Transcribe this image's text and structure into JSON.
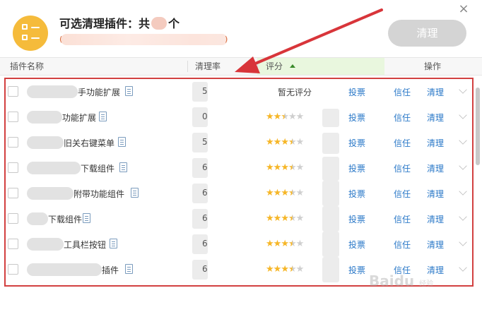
{
  "header": {
    "title_prefix": "可选清理插件：共",
    "title_suffix": "个",
    "subtitle_open": "(",
    "subtitle_close": ")",
    "clean_button": "清理",
    "close_icon": "×"
  },
  "table": {
    "columns": {
      "name": "插件名称",
      "rate": "清理率",
      "rating": "评分",
      "action": "操作"
    },
    "sort_indicator": "ascending",
    "rows": [
      {
        "name": "手功能扩展",
        "rate": "5",
        "rating": null,
        "rating_text": "暂无评分",
        "vote": "投票",
        "trust": "信任",
        "clean": "清理"
      },
      {
        "name": "功能扩展",
        "rate": "0",
        "rating": 2.5,
        "vote": "投票",
        "trust": "信任",
        "clean": "清理"
      },
      {
        "name": "旧关右键菜单",
        "rate": "5",
        "rating": 3.5,
        "vote": "投票",
        "trust": "信任",
        "clean": "清理"
      },
      {
        "name": "下载组件",
        "rate": "6",
        "rating": 3.5,
        "vote": "投票",
        "trust": "信任",
        "clean": "清理"
      },
      {
        "name": "附带功能组件",
        "rate": "6",
        "rating": 3.5,
        "vote": "投票",
        "trust": "信任",
        "clean": "清理"
      },
      {
        "name": "下载组件",
        "rate": "6",
        "rating": 3.5,
        "vote": "投票",
        "trust": "信任",
        "clean": "清理"
      },
      {
        "name": "工具栏按钮",
        "rate": "6",
        "rating": 3.5,
        "vote": "投票",
        "trust": "信任",
        "clean": "清理"
      },
      {
        "name": "插件",
        "rate": "6",
        "rating": 3.5,
        "vote": "投票",
        "trust": "信任",
        "clean": "清理"
      }
    ]
  },
  "watermark": {
    "brand": "Baidu",
    "sub": "经验"
  },
  "colors": {
    "accent": "#f5bb3b",
    "link": "#2a78c8",
    "highlight": "#d24040",
    "star": "#f6b627",
    "rating_header_bg": "#e9f7de"
  },
  "icons": {
    "app": "plugin-list-icon",
    "close": "close-icon",
    "doc": "document-icon",
    "expand": "chevron-down-icon"
  }
}
